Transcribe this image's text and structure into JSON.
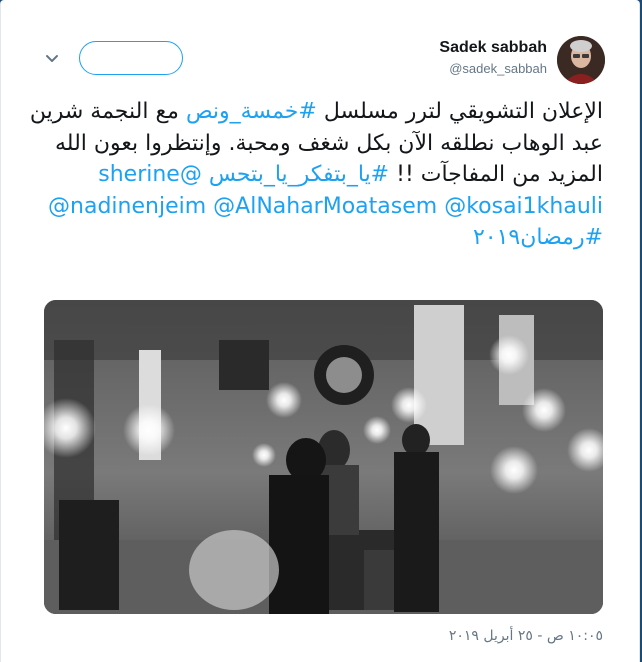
{
  "tweet": {
    "author": {
      "display_name": "Sadek sabbah",
      "handle": "@sadek_sabbah",
      "avatar_icon": "profile-photo"
    },
    "follow_button": {
      "label": ""
    },
    "menu_icon": "chevron-down-icon",
    "text_parts": [
      {
        "text": "الإعلان التشويقي لترر مسلسل ",
        "type": "text"
      },
      {
        "text": "#خمسة_ونص",
        "type": "link"
      },
      {
        "text": " مع النجمة شرين عبد الوهاب نطلقه الآن بكل شغف ومحبة. وإنتظروا بعون الله المزيد من المفاجآت !! ",
        "type": "text"
      },
      {
        "text": "#يا_بتفكر_يا_بتحس",
        "type": "link"
      },
      {
        "text": " ",
        "type": "text"
      },
      {
        "text": "@sherine",
        "type": "link"
      },
      {
        "text": " ",
        "type": "text"
      },
      {
        "text": "@nadinenjeim",
        "type": "link"
      },
      {
        "text": " ",
        "type": "text"
      },
      {
        "text": "@AlNaharMoatasem",
        "type": "link"
      },
      {
        "text": " ",
        "type": "text"
      },
      {
        "text": "@kosai1khauli",
        "type": "link"
      },
      {
        "text": " ",
        "type": "text"
      },
      {
        "text": "#رمضان٢٠١٩",
        "type": "link"
      }
    ],
    "media": {
      "type": "photo",
      "description_icon": "video-set-photo"
    },
    "timestamp": "١٠:٠٥ ص - ٢٥ أبريل ٢٠١٩"
  },
  "colors": {
    "link": "#1da1f2",
    "text": "#14171a",
    "muted": "#657786",
    "backdrop": "#1b4a75"
  }
}
